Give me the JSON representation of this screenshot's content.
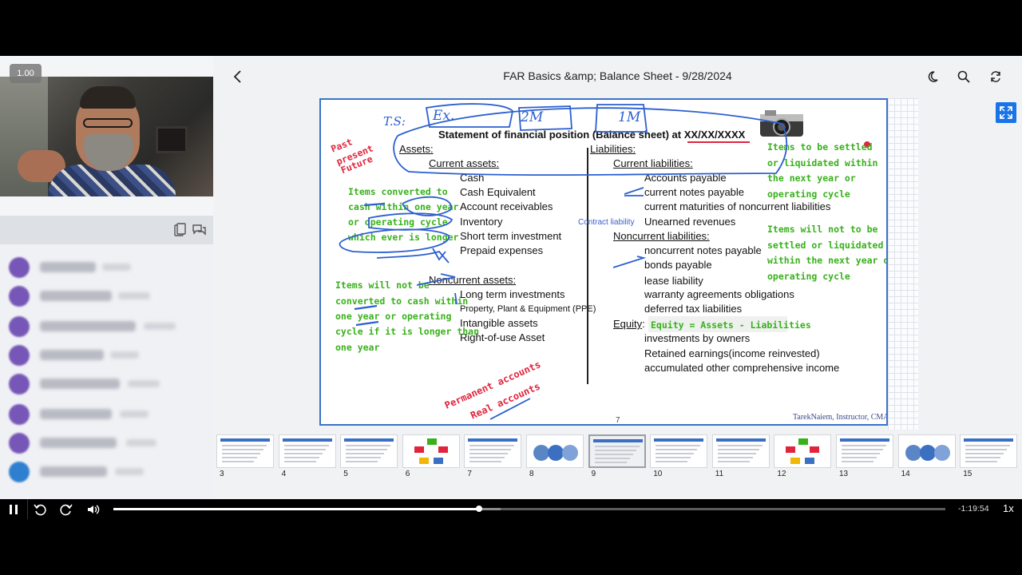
{
  "header": {
    "title": "FAR Basics &amp; Balance Sheet - 9/28/2024"
  },
  "video": {
    "speed_badge": "1.00"
  },
  "slide": {
    "title": "Statement of financial position (Balance sheet) at XX/XX/XXXX",
    "assets": {
      "heading": "Assets:",
      "current_heading": "Current assets:",
      "current_items": [
        "Cash",
        "Cash Equivalent",
        "Account receivables",
        "Inventory",
        "Short term investment",
        "Prepaid expenses"
      ],
      "noncurrent_heading": "Noncurrent assets:",
      "noncurrent_items": [
        "Long term investments",
        "Property, Plant & Equipment (PPE)",
        "Intangible assets",
        "Right-of-use Asset"
      ]
    },
    "liabilities": {
      "heading": "Liabilities:",
      "current_heading": "Current liabilities:",
      "current_items": [
        "Accounts payable",
        "current notes payable",
        "current maturities of noncurrent liabilities",
        "Unearned revenues"
      ],
      "noncurrent_heading": "Noncurrent liabilities:",
      "noncurrent_items": [
        "noncurrent notes payable",
        "bonds payable",
        "lease liability",
        "warranty agreements obligations",
        "deferred tax liabilities"
      ]
    },
    "equity": {
      "heading": "Equity",
      "formula": "Equity = Assets - Liabilities",
      "items": [
        "investments by owners",
        "Retained earnings(income reinvested)",
        "accumulated other comprehensive income"
      ]
    },
    "annotations": {
      "past_present_future": [
        "Past",
        "present",
        "Future"
      ],
      "current_assets_note": [
        "Items converted to",
        "cash within one year",
        "or operating cycle",
        "which ever is longer"
      ],
      "noncurrent_assets_note": [
        "Items will not be",
        "converted to cash within",
        "one year or operating",
        "cycle if it is longer than",
        "one year"
      ],
      "current_liab_note": [
        "Items to be settled",
        "or liquidated within",
        "the next year or",
        "operating cycle"
      ],
      "noncurrent_liab_note": [
        "Items will not to be",
        "settled or liquidated",
        "within the next year or",
        "operating cycle"
      ],
      "contract_liability": "Contract liability",
      "permanent_accounts": [
        "Permanent accounts",
        "Real accounts"
      ],
      "top_ink": [
        "T.S:",
        "Ex.",
        "2M",
        "1M"
      ]
    },
    "page_number": "7",
    "footer": "TarekNaiem, Instructor, CMA"
  },
  "thumbnails": [
    {
      "num": "3"
    },
    {
      "num": "4"
    },
    {
      "num": "5"
    },
    {
      "num": "6"
    },
    {
      "num": "7"
    },
    {
      "num": "8"
    },
    {
      "num": "9",
      "active": true
    },
    {
      "num": "10"
    },
    {
      "num": "11"
    },
    {
      "num": "12"
    },
    {
      "num": "13"
    },
    {
      "num": "14"
    },
    {
      "num": "15"
    }
  ],
  "player": {
    "time_remaining": "-1:19:54",
    "rate": "1x",
    "progress": 0.44,
    "buffered": 0.465
  },
  "colors": {
    "accent": "#1a73e8",
    "slide_border": "#3b73c7",
    "green_ink": "#38b11b",
    "red_ink": "#e0243c",
    "blue_ink": "#2b5fd0"
  }
}
